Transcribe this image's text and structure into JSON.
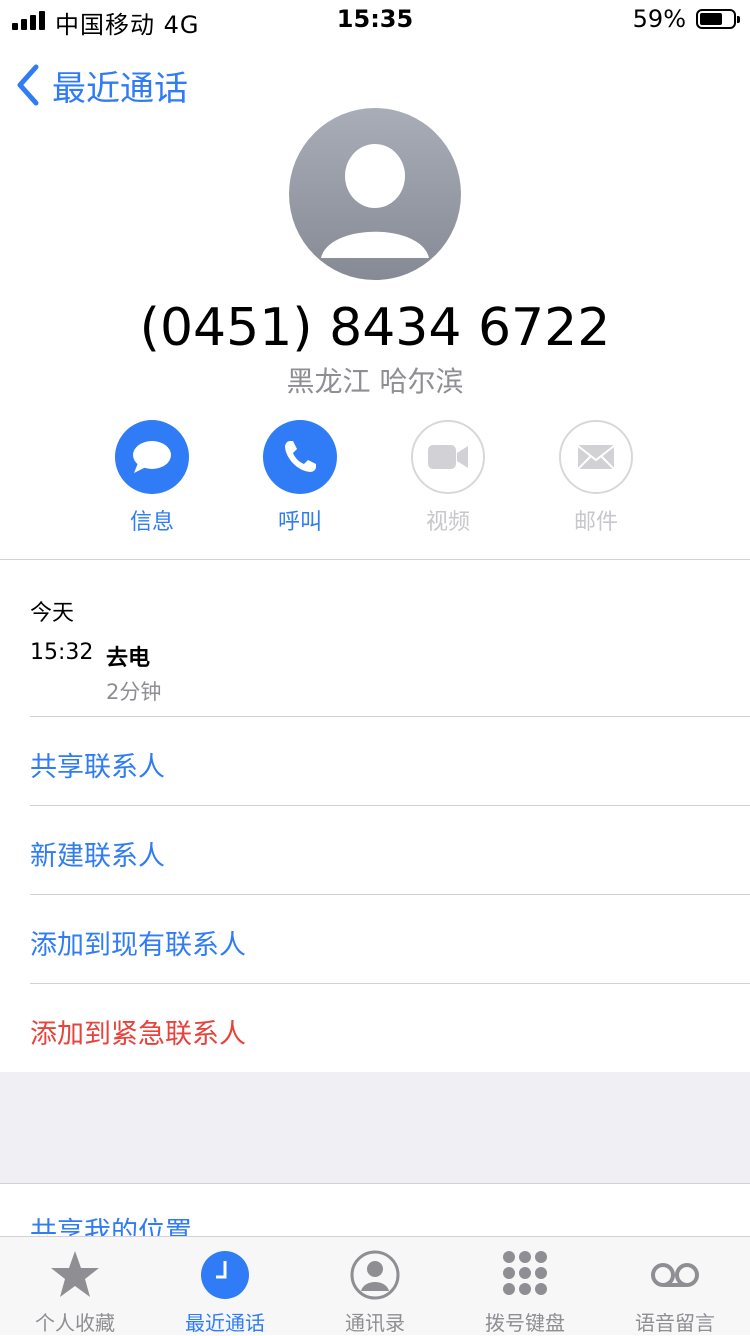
{
  "status_bar": {
    "carrier": "中国移动  4G",
    "time": "15:35",
    "battery": "59%"
  },
  "nav": {
    "back_label": "最近通话"
  },
  "contact": {
    "number": "(0451) 8434 6722",
    "location": "黑龙江 哈尔滨"
  },
  "actions": [
    {
      "label": "信息",
      "icon": "message-icon",
      "enabled": true
    },
    {
      "label": "呼叫",
      "icon": "phone-icon",
      "enabled": true
    },
    {
      "label": "视频",
      "icon": "video-icon",
      "enabled": false
    },
    {
      "label": "邮件",
      "icon": "mail-icon",
      "enabled": false
    }
  ],
  "call_history": {
    "day": "今天",
    "time": "15:32",
    "type": "去电",
    "duration": "2分钟"
  },
  "menu": {
    "share_contact": "共享联系人",
    "new_contact": "新建联系人",
    "add_existing": "添加到现有联系人",
    "add_emergency": "添加到紧急联系人",
    "share_location": "共享我的位置"
  },
  "tabs": [
    {
      "label": "个人收藏",
      "icon": "star-icon",
      "active": false
    },
    {
      "label": "最近通话",
      "icon": "clock-icon",
      "active": true
    },
    {
      "label": "通讯录",
      "icon": "contacts-icon",
      "active": false
    },
    {
      "label": "拨号键盘",
      "icon": "keypad-icon",
      "active": false
    },
    {
      "label": "语音留言",
      "icon": "voicemail-icon",
      "active": false
    }
  ],
  "colors": {
    "accent": "#2f7cf6",
    "danger": "#e8423b",
    "secondary_text": "#8e8e93"
  }
}
